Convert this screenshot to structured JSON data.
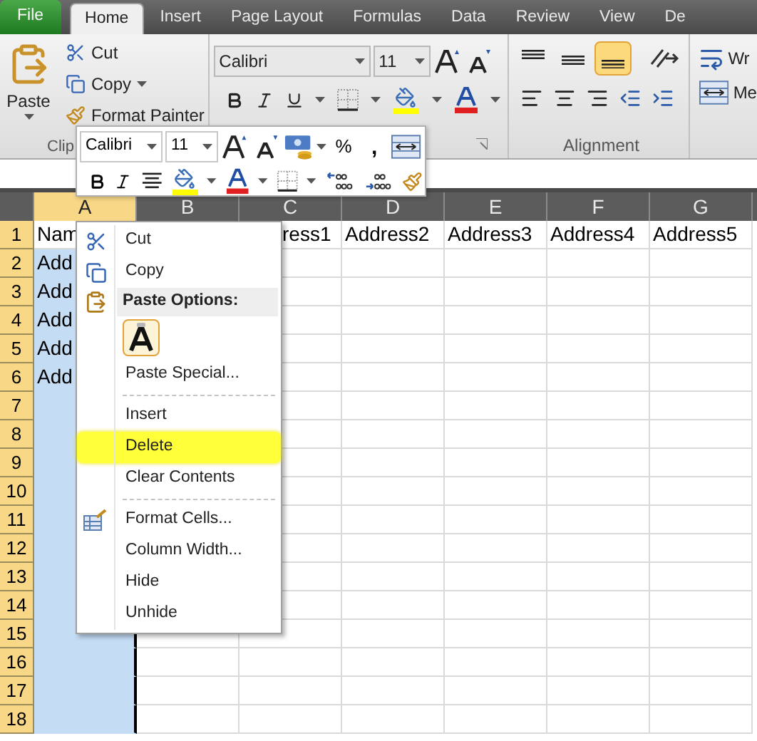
{
  "ribbon_tabs": [
    {
      "label": "File",
      "kind": "file",
      "selected": false
    },
    {
      "label": "Home",
      "kind": "tab",
      "selected": true
    },
    {
      "label": "Insert",
      "kind": "tab",
      "selected": false
    },
    {
      "label": "Page Layout",
      "kind": "tab",
      "selected": false
    },
    {
      "label": "Formulas",
      "kind": "tab",
      "selected": false
    },
    {
      "label": "Data",
      "kind": "tab",
      "selected": false
    },
    {
      "label": "Review",
      "kind": "tab",
      "selected": false
    },
    {
      "label": "View",
      "kind": "tab",
      "selected": false
    },
    {
      "label": "De",
      "kind": "tab",
      "selected": false
    }
  ],
  "clipboard": {
    "paste": "Paste",
    "cut": "Cut",
    "copy": "Copy",
    "format_painter": "Format Painter",
    "group_label": "Clip"
  },
  "font_group": {
    "font": "Calibri",
    "size": "11"
  },
  "alignment_group": {
    "label": "Alignment",
    "wrap": "Wr",
    "merge": "Me"
  },
  "mini_toolbar": {
    "font": "Calibri",
    "size": "11",
    "percent": "%",
    "comma": ","
  },
  "sheet": {
    "columns": [
      {
        "label": "A",
        "selected": true
      },
      {
        "label": "B",
        "selected": false
      },
      {
        "label": "C",
        "selected": false
      },
      {
        "label": "D",
        "selected": false
      },
      {
        "label": "E",
        "selected": false
      },
      {
        "label": "F",
        "selected": false
      },
      {
        "label": "G",
        "selected": false
      }
    ],
    "rows": [
      {
        "number": "1",
        "highlighted": true,
        "active_cell_in_selected_column": true,
        "cells": {
          "A": "Nam",
          "C": "ress1",
          "D": "Address2",
          "E": "Address3",
          "F": "Address4",
          "G": "Address5"
        }
      },
      {
        "number": "2",
        "highlighted": true,
        "cells": {
          "A": "Add"
        }
      },
      {
        "number": "3",
        "highlighted": true,
        "cells": {
          "A": "Add"
        }
      },
      {
        "number": "4",
        "highlighted": true,
        "cells": {
          "A": "Add"
        }
      },
      {
        "number": "5",
        "highlighted": true,
        "cells": {
          "A": "Add"
        }
      },
      {
        "number": "6",
        "highlighted": true,
        "cells": {
          "A": "Add"
        }
      },
      {
        "number": "7",
        "highlighted": true,
        "cells": {}
      },
      {
        "number": "8",
        "highlighted": true,
        "cells": {}
      },
      {
        "number": "9",
        "highlighted": true,
        "cells": {}
      },
      {
        "number": "10",
        "highlighted": true,
        "cells": {}
      },
      {
        "number": "11",
        "highlighted": true,
        "cells": {}
      },
      {
        "number": "12",
        "highlighted": true,
        "cells": {}
      },
      {
        "number": "13",
        "highlighted": true,
        "cells": {}
      },
      {
        "number": "14",
        "highlighted": true,
        "cells": {}
      },
      {
        "number": "15",
        "highlighted": true,
        "cells": {}
      },
      {
        "number": "16",
        "highlighted": true,
        "cells": {}
      },
      {
        "number": "17",
        "highlighted": true,
        "cells": {}
      },
      {
        "number": "18",
        "highlighted": true,
        "cells": {}
      }
    ]
  },
  "context_menu": [
    {
      "kind": "cut",
      "label": "Cut",
      "highlighted": false
    },
    {
      "kind": "copy",
      "label": "Copy",
      "highlighted": false
    },
    {
      "kind": "header",
      "label": "Paste Options:"
    },
    {
      "kind": "paste_option"
    },
    {
      "kind": "item",
      "label": "Paste Special...",
      "highlighted": false
    },
    {
      "kind": "separator"
    },
    {
      "kind": "item",
      "label": "Insert",
      "highlighted": false
    },
    {
      "kind": "item",
      "label": "Delete",
      "highlighted": true
    },
    {
      "kind": "item",
      "label": "Clear Contents",
      "highlighted": false
    },
    {
      "kind": "separator"
    },
    {
      "kind": "format",
      "label": "Format Cells...",
      "highlighted": false
    },
    {
      "kind": "item",
      "label": "Column Width...",
      "highlighted": false
    },
    {
      "kind": "item",
      "label": "Hide",
      "highlighted": false
    },
    {
      "kind": "item",
      "label": "Unhide",
      "highlighted": false
    }
  ]
}
